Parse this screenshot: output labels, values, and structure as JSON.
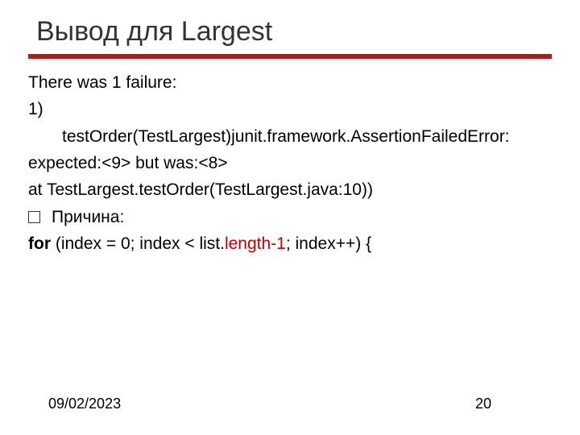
{
  "title": "Вывод для Largest",
  "lines": {
    "failure_header": "There was 1 failure:",
    "item_num": "1)",
    "item_text": "testOrder(TestLargest)junit.framework.AssertionFailedError:",
    "expected": "expected:<9> but was:<8>",
    "at_line": "at TestLargest.testOrder(TestLargest.java:10))",
    "reason_label": "Причина:",
    "code_for": "for",
    "code_rest1": " (index = 0; index < list.",
    "code_highlight": "length-1",
    "code_rest2": "; index++) {"
  },
  "footer": {
    "date": "09/02/2023",
    "page": "20"
  }
}
